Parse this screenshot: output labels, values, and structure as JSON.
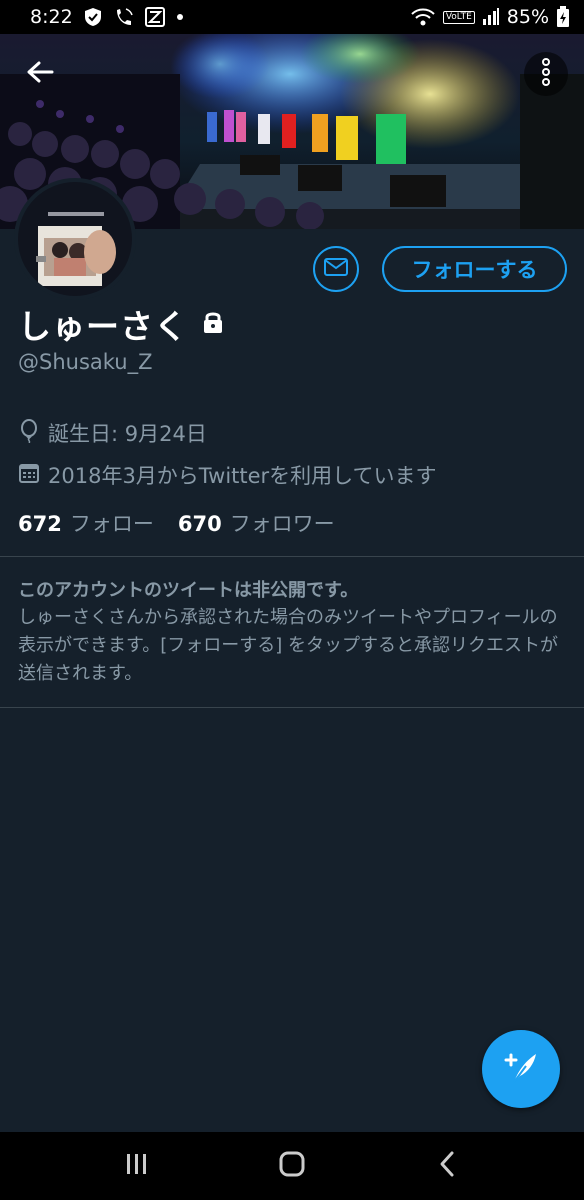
{
  "status_bar": {
    "time": "8:22",
    "battery": "85%",
    "volte": "VoLTE",
    "left_icons": [
      "shield-check-icon",
      "wifi-calling-icon",
      "app-z-icon",
      "dot-icon"
    ],
    "right_icons": [
      "wifi-icon",
      "volte-icon",
      "signal-icon",
      "battery-charging-icon"
    ]
  },
  "profile": {
    "display_name": "しゅーさく",
    "handle": "@Shusaku_Z",
    "locked": true,
    "birthday": "誕生日: 9月24日",
    "joined": "2018年3月からTwitterを利用しています",
    "following_count": "672",
    "following_label": "フォロー",
    "followers_count": "670",
    "followers_label": "フォロワー"
  },
  "actions": {
    "follow_label": "フォローする"
  },
  "private_notice": {
    "title": "このアカウントのツイートは非公開です。",
    "body": "しゅーさくさんから承認された場合のみツイートやプロフィールの表示ができます。[フォローする] をタップすると承認リクエストが送信されます。"
  },
  "colors": {
    "background": "#15202b",
    "accent": "#1da1f2",
    "secondary_text": "#8899a6",
    "divider": "#38444d"
  },
  "icons": {
    "back": "arrow-left-icon",
    "more": "more-vertical-icon",
    "message": "envelope-icon",
    "lock": "lock-icon",
    "birthday": "balloon-icon",
    "calendar": "calendar-icon",
    "compose": "compose-tweet-icon"
  }
}
